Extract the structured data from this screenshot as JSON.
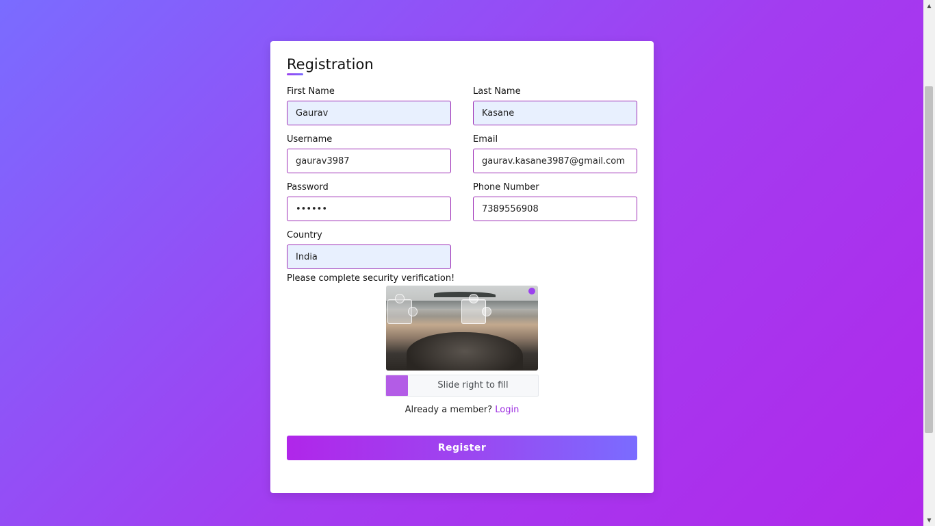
{
  "form": {
    "title": "Registration",
    "fields": {
      "first_name": {
        "label": "First Name",
        "value": "Gaurav"
      },
      "last_name": {
        "label": "Last Name",
        "value": "Kasane"
      },
      "username": {
        "label": "Username",
        "value": "gaurav3987"
      },
      "email": {
        "label": "Email",
        "value": "gaurav.kasane3987@gmail.com"
      },
      "password": {
        "label": "Password",
        "value": "••••••"
      },
      "phone": {
        "label": "Phone Number",
        "value": "7389556908"
      },
      "country": {
        "label": "Country",
        "value": "India"
      }
    },
    "security_message": "Please complete security verification!",
    "captcha": {
      "slider_text": "Slide right to fill"
    },
    "member_prompt": "Already a member?",
    "login_link": "Login",
    "register_button": "Register"
  },
  "colors": {
    "accent": "#9b2ae0",
    "border": "#9b2ab5",
    "autofill_bg": "#e8f0fe",
    "slider_handle": "#b35ce6"
  }
}
